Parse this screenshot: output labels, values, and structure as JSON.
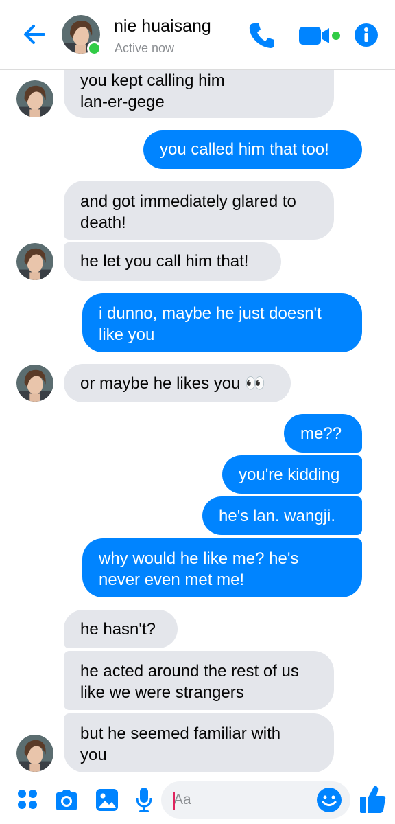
{
  "header": {
    "contact_name": "nie huaisang",
    "status": "Active now",
    "back_icon": "back-arrow-icon",
    "call_icon": "phone-icon",
    "video_icon": "video-camera-icon",
    "info_icon": "info-icon"
  },
  "colors": {
    "accent": "#0084ff",
    "incoming_bubble": "#e4e6eb",
    "online": "#31cc46"
  },
  "messages": [
    {
      "from": "them",
      "text": "you kept calling him\nlan-er-gege"
    },
    {
      "from": "me",
      "text": "you called him that too!"
    },
    {
      "from": "them",
      "text": "and got immediately glared to\ndeath!"
    },
    {
      "from": "them",
      "text": "he let you call him that!"
    },
    {
      "from": "me",
      "text": "i dunno, maybe he just doesn't\nlike you"
    },
    {
      "from": "them",
      "text": "or maybe he likes you 👀"
    },
    {
      "from": "me",
      "text": "me??"
    },
    {
      "from": "me",
      "text": "you're kidding"
    },
    {
      "from": "me",
      "text": "he's lan. wangji."
    },
    {
      "from": "me",
      "text": "why would he like me? he's\nnever even met me!"
    },
    {
      "from": "them",
      "text": "he hasn't?"
    },
    {
      "from": "them",
      "text": "he acted around the rest of us\nlike we were strangers"
    },
    {
      "from": "them",
      "text": "but he seemed familiar with\nyou"
    }
  ],
  "composer": {
    "placeholder": "Aa",
    "icons": [
      "apps-icon",
      "camera-icon",
      "gallery-icon",
      "microphone-icon",
      "emoji-icon",
      "thumbs-up-icon"
    ]
  }
}
